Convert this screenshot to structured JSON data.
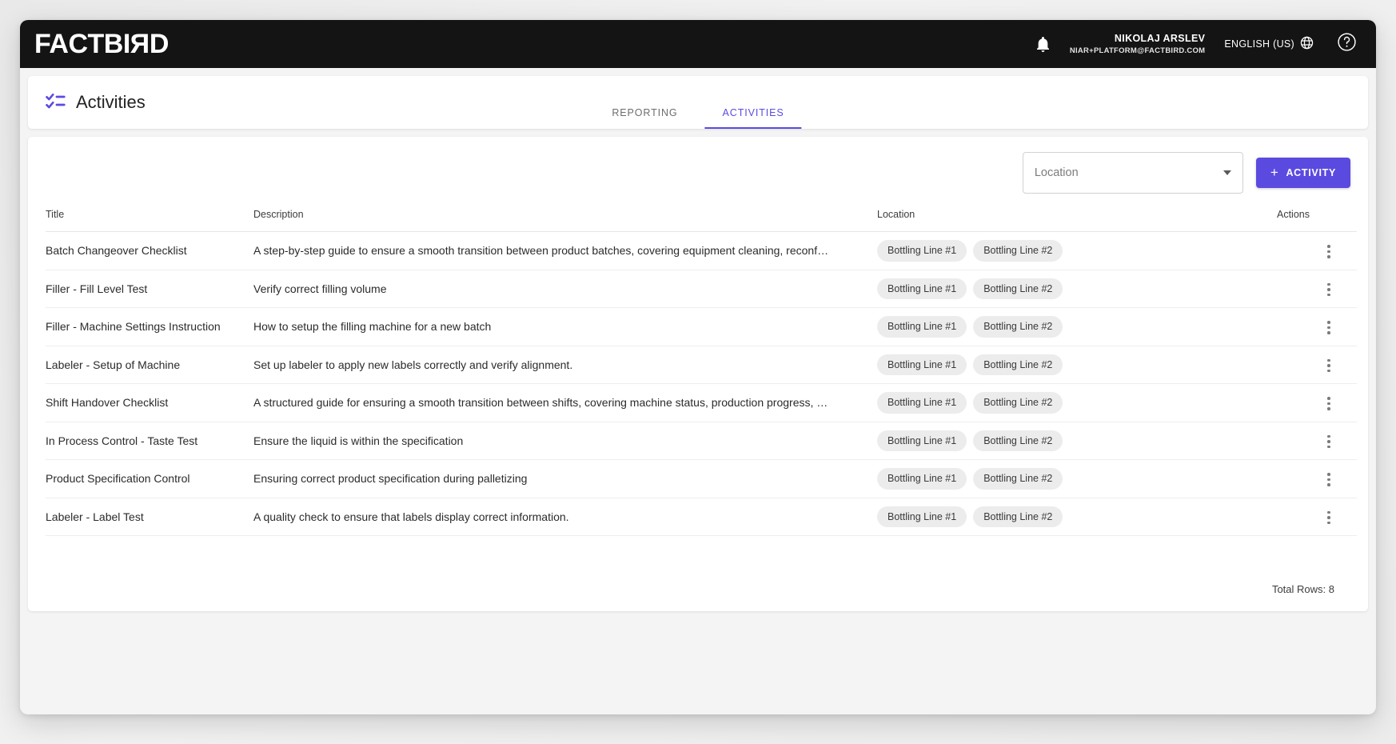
{
  "app": {
    "logo_text_before": "FACTBI",
    "logo_text_mirrored": "R",
    "logo_text_after": "D"
  },
  "topbar": {
    "notifications_icon": "bell-icon",
    "user_name": "NIKOLAJ ARSLEV",
    "user_email": "NIAR+PLATFORM@FACTBIRD.COM",
    "language_label": "ENGLISH (US)",
    "language_icon": "globe-icon",
    "help_icon": "help-circle-icon"
  },
  "page": {
    "icon": "checklist-icon",
    "title": "Activities",
    "tabs": [
      {
        "label": "REPORTING",
        "active": false
      },
      {
        "label": "ACTIVITIES",
        "active": true
      }
    ]
  },
  "toolbar": {
    "location_filter_placeholder": "Location",
    "location_filter_value": "",
    "dropdown_icon": "chevron-down-icon",
    "add_activity_label": "ACTIVITY",
    "add_activity_plus": "+"
  },
  "table": {
    "columns": [
      "Title",
      "Description",
      "Location",
      "Actions"
    ],
    "rows": [
      {
        "title": "Batch Changeover Checklist",
        "description": "A step-by-step guide to ensure a smooth transition between product batches, covering equipment cleaning, reconf…",
        "locations": [
          "Bottling Line #1",
          "Bottling Line #2"
        ],
        "actions_icon": "kebab-menu-icon"
      },
      {
        "title": "Filler - Fill Level Test",
        "description": "Verify correct filling volume",
        "locations": [
          "Bottling Line #1",
          "Bottling Line #2"
        ],
        "actions_icon": "kebab-menu-icon"
      },
      {
        "title": "Filler - Machine Settings Instruction",
        "description": "How to setup the filling machine for a new batch",
        "locations": [
          "Bottling Line #1",
          "Bottling Line #2"
        ],
        "actions_icon": "kebab-menu-icon"
      },
      {
        "title": "Labeler - Setup of Machine",
        "description": "Set up labeler to apply new labels correctly and verify alignment.",
        "locations": [
          "Bottling Line #1",
          "Bottling Line #2"
        ],
        "actions_icon": "kebab-menu-icon"
      },
      {
        "title": "Shift Handover Checklist",
        "description": "A structured guide for ensuring a smooth transition between shifts, covering machine status, production progress, …",
        "locations": [
          "Bottling Line #1",
          "Bottling Line #2"
        ],
        "actions_icon": "kebab-menu-icon"
      },
      {
        "title": "In Process Control - Taste Test",
        "description": "Ensure the liquid is within the specification",
        "locations": [
          "Bottling Line #1",
          "Bottling Line #2"
        ],
        "actions_icon": "kebab-menu-icon"
      },
      {
        "title": "Product Specification Control",
        "description": "Ensuring correct product specification during palletizing",
        "locations": [
          "Bottling Line #1",
          "Bottling Line #2"
        ],
        "actions_icon": "kebab-menu-icon"
      },
      {
        "title": "Labeler - Label Test",
        "description": "A quality check to ensure that labels display correct information.",
        "locations": [
          "Bottling Line #1",
          "Bottling Line #2"
        ],
        "actions_icon": "kebab-menu-icon"
      }
    ],
    "total_rows_label": "Total Rows: 8"
  },
  "colors": {
    "accent_purple": "#5B4AE0",
    "topbar_black": "#141414",
    "chip_gray": "#ECECEC",
    "page_bg": "#F4F4F4"
  }
}
